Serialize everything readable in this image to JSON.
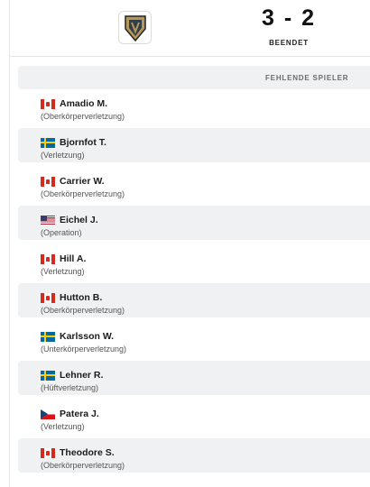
{
  "match": {
    "score": "3 - 2",
    "status": "BEENDET",
    "team_logo": "vegas-golden-knights-logo"
  },
  "section": {
    "title": "FEHLENDE SPIELER"
  },
  "players": [
    {
      "name": "Amadio M.",
      "reason": "(Oberkörperverletzung)",
      "flag": "canada-flag"
    },
    {
      "name": "Bjornfot T.",
      "reason": "(Verletzung)",
      "flag": "sweden-flag"
    },
    {
      "name": "Carrier W.",
      "reason": "(Oberkörperverletzung)",
      "flag": "canada-flag"
    },
    {
      "name": "Eichel J.",
      "reason": "(Operation)",
      "flag": "usa-flag"
    },
    {
      "name": "Hill A.",
      "reason": "(Verletzung)",
      "flag": "canada-flag"
    },
    {
      "name": "Hutton B.",
      "reason": "(Oberkörperverletzung)",
      "flag": "canada-flag"
    },
    {
      "name": "Karlsson W.",
      "reason": "(Unterkörperverletzung)",
      "flag": "sweden-flag"
    },
    {
      "name": "Lehner R.",
      "reason": "(Hüftverletzung)",
      "flag": "sweden-flag"
    },
    {
      "name": "Patera J.",
      "reason": "(Verletzung)",
      "flag": "czech-flag"
    },
    {
      "name": "Theodore S.",
      "reason": "(Oberkörperverletzung)",
      "flag": "canada-flag"
    }
  ]
}
